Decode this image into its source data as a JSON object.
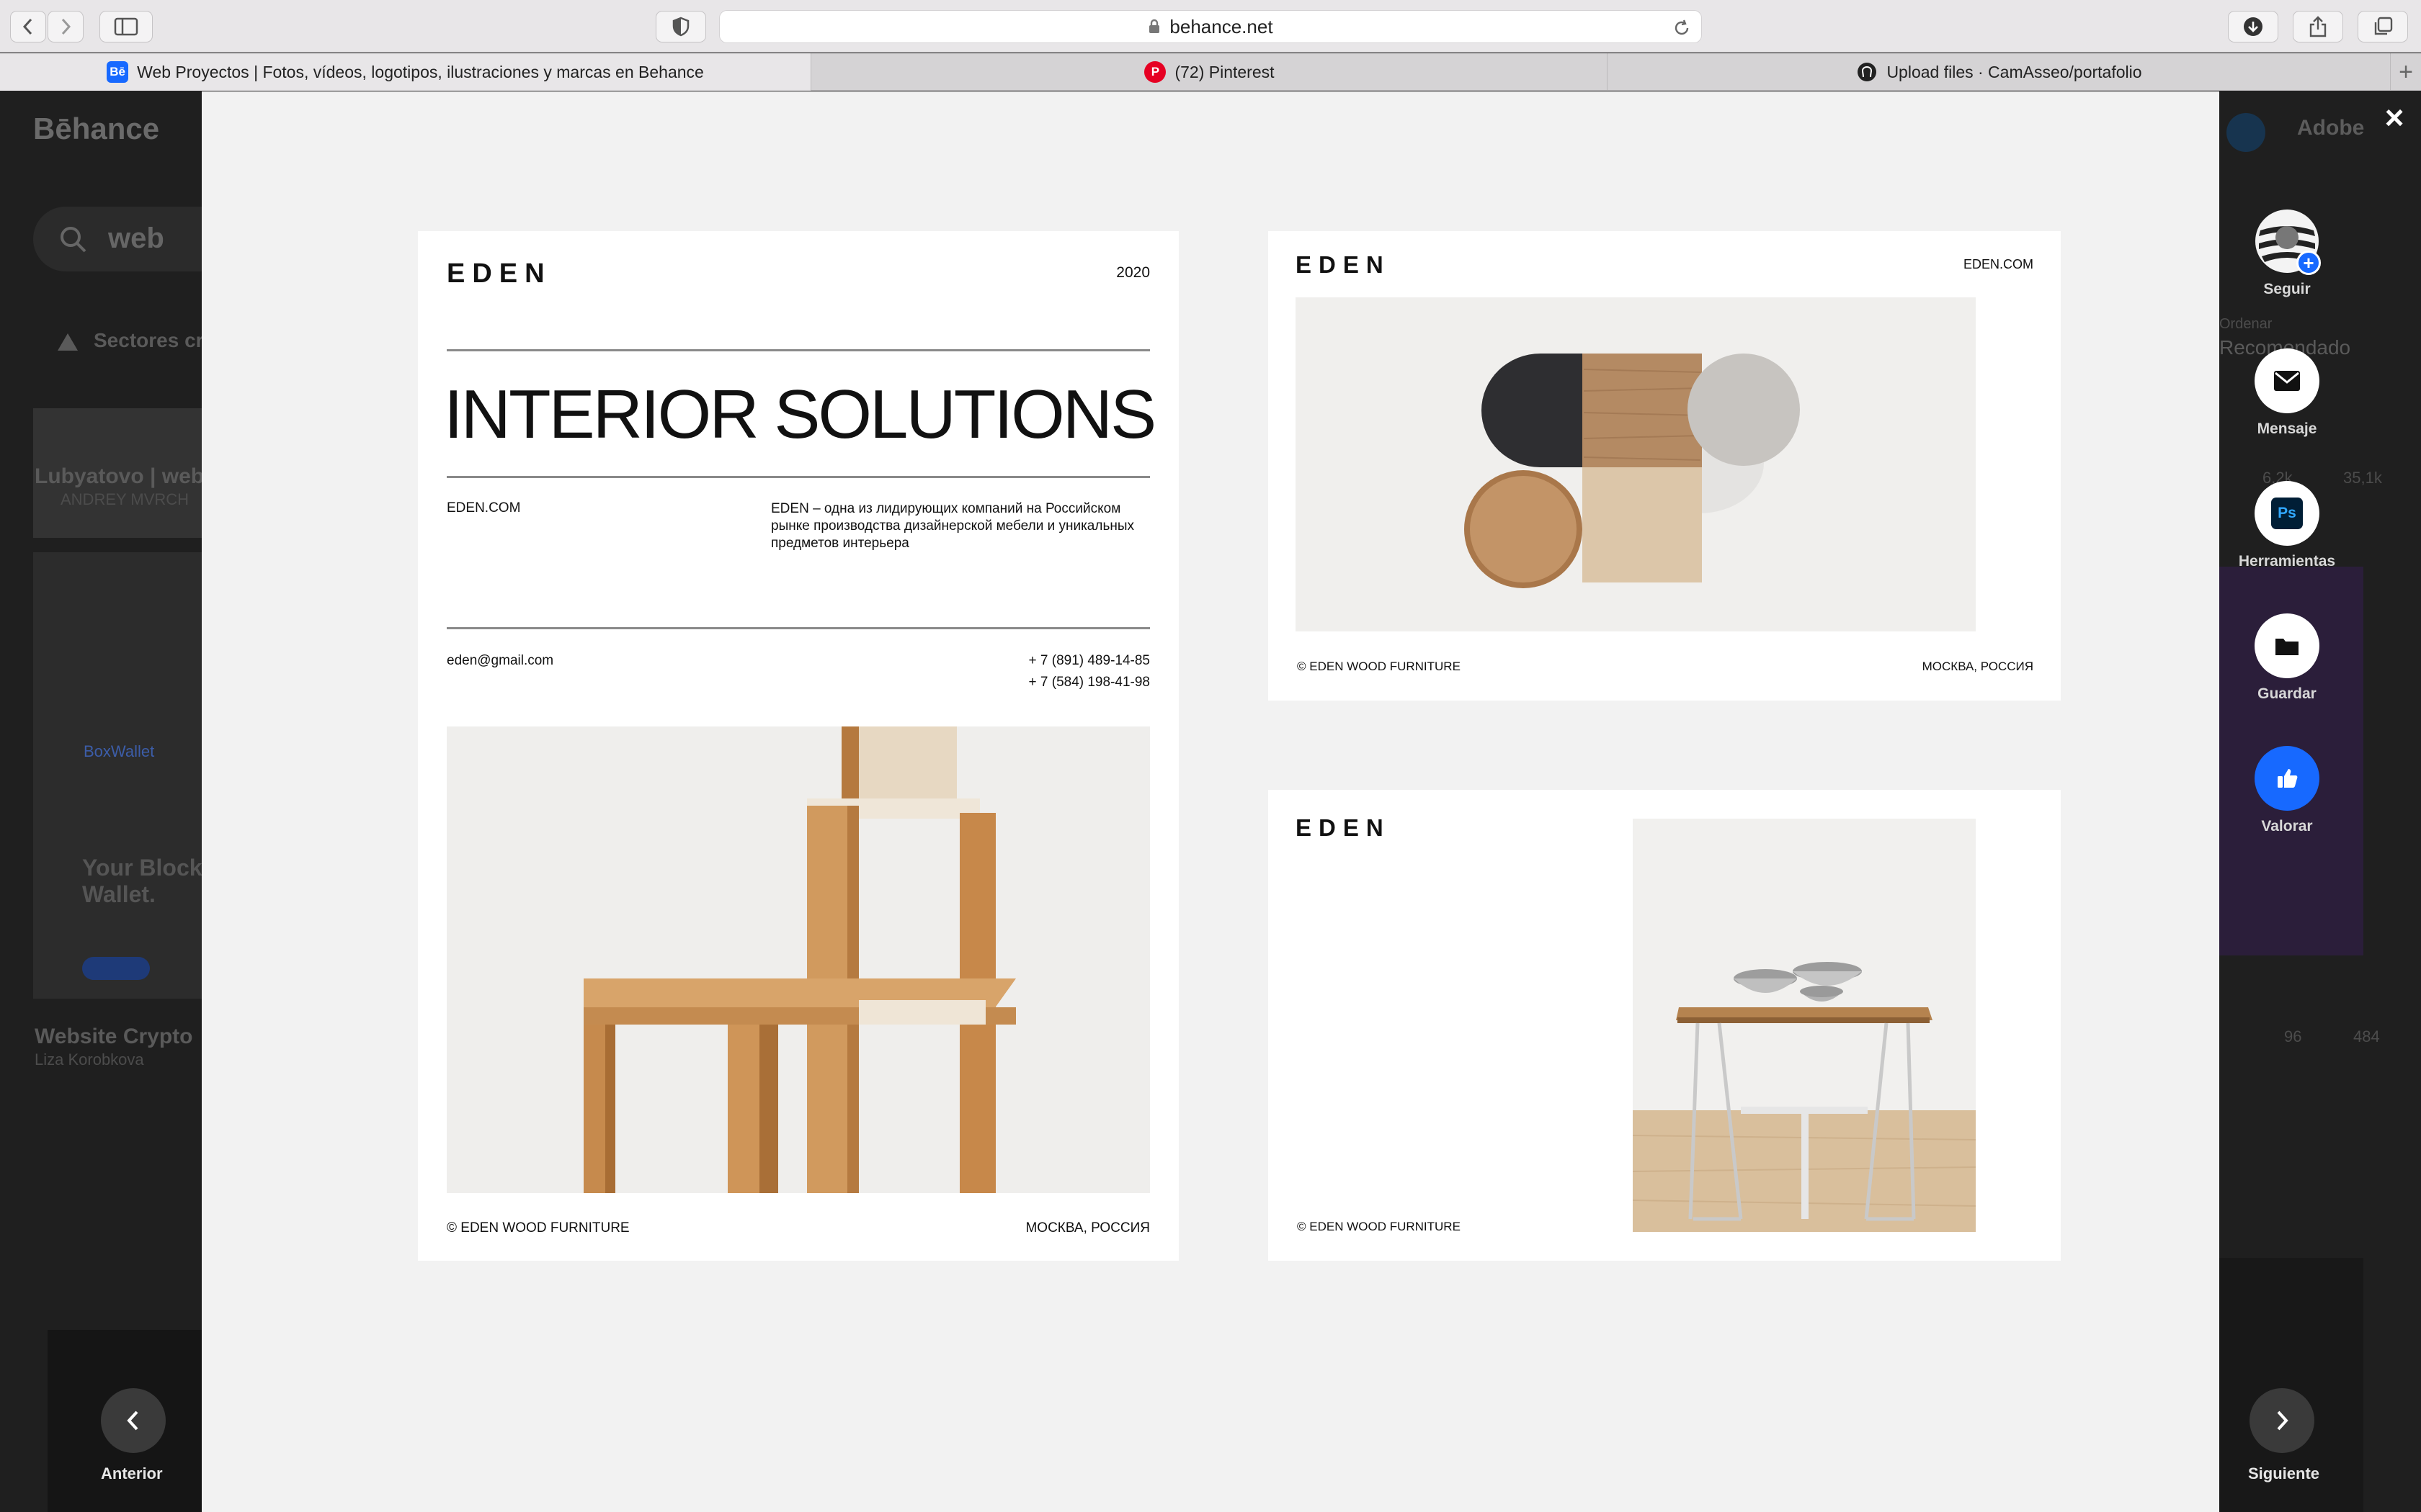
{
  "browser": {
    "url": "behance.net",
    "tabs": [
      {
        "label": "Web Proyectos | Fotos, vídeos, logotipos, ilustraciones y marcas en Behance",
        "favicon": "Bē"
      },
      {
        "label": "(72) Pinterest",
        "favicon": "P"
      },
      {
        "label": "Upload files · CamAsseo/portafolio",
        "favicon": "github"
      }
    ]
  },
  "background": {
    "logo": "Bēhance",
    "search_value": "web",
    "sectors_label": "Sectores cr",
    "adobe_label": "Adobe",
    "sort_caption": "Ordenar",
    "sort_value": "Recomendado",
    "project1_title": "Lubyatovo | web",
    "project1_author": "ANDREY MVRCH",
    "project1_likes": "6,2k",
    "project1_views": "35,1k",
    "boxwallet_brand": "BoxWallet",
    "boxwallet_headline": "Your Block Wallet.",
    "project2_title": "Website Crypto",
    "project2_author": "Liza Korobkova",
    "project2_likes": "96",
    "project2_views": "484"
  },
  "modal": {
    "close_label": "×",
    "card1": {
      "logo": "EDEN",
      "year": "2020",
      "headline": "INTERIOR SOLUTIONS",
      "site": "EDEN.COM",
      "description": "EDEN – одна из лидирующих компаний на Российском рынке производства дизайнерской мебели и уникальных предметов интерьера",
      "email": "eden@gmail.com",
      "phone1": "+ 7 (891) 489-14-85",
      "phone2": "+ 7 (584) 198-41-98",
      "footer_left": "© EDEN WOOD FURNITURE",
      "footer_right": "МОСКВА, РОССИЯ"
    },
    "card2": {
      "logo": "EDEN",
      "site": "EDEN.COM",
      "footer_left": "© EDEN WOOD FURNITURE",
      "footer_right": "МОСКВА, РОССИЯ"
    },
    "card3": {
      "logo": "EDEN",
      "footer_left": "© EDEN WOOD FURNITURE"
    }
  },
  "rail": {
    "follow": "Seguir",
    "message": "Mensaje",
    "tools": "Herramientas",
    "tools_icon_text": "Ps",
    "save": "Guardar",
    "appreciate": "Valorar"
  },
  "nav": {
    "prev": "Anterior",
    "next": "Siguiente"
  },
  "colors": {
    "behance_blue": "#1769ff",
    "modal_bg": "#f2f2f2",
    "overlay": "#1f1f1f"
  }
}
